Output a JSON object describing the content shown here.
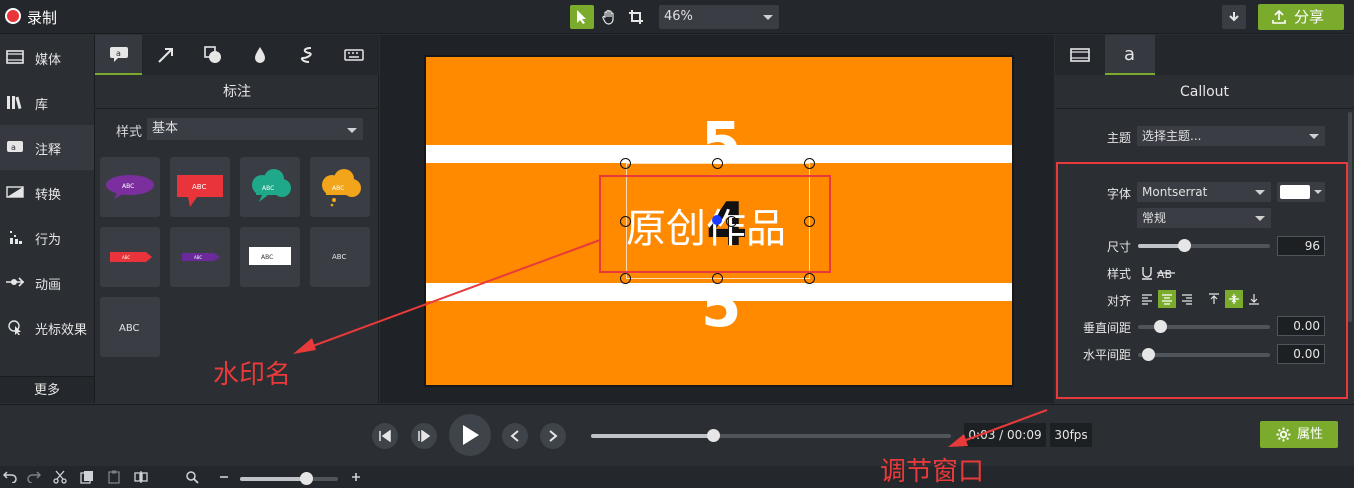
{
  "topbar": {
    "record_label": "录制",
    "zoom_value": "46%",
    "share_label": "分享"
  },
  "nav": {
    "items": [
      {
        "label": "媒体",
        "icon": "film-icon"
      },
      {
        "label": "库",
        "icon": "library-icon"
      },
      {
        "label": "注释",
        "icon": "annotation-icon",
        "active": true
      },
      {
        "label": "转换",
        "icon": "transition-icon"
      },
      {
        "label": "行为",
        "icon": "behavior-icon"
      },
      {
        "label": "动画",
        "icon": "animation-icon"
      },
      {
        "label": "光标效果",
        "icon": "cursor-effect-icon"
      }
    ],
    "more_label": "更多"
  },
  "annotations": {
    "title": "标注",
    "style_label": "样式",
    "style_value": "基本",
    "tiles": [
      "ABC",
      "ABC",
      "ABC",
      "ABC",
      "ABC",
      "ABC",
      "ABC",
      "ABC",
      "ABC"
    ]
  },
  "canvas": {
    "num_top": "5",
    "num_mid": "4",
    "num_bottom": "5",
    "callout_text": "原创作品"
  },
  "properties": {
    "title": "Callout",
    "theme_label": "主题",
    "theme_value": "选择主题...",
    "font_label": "字体",
    "font_value": "Montserrat",
    "weight_value": "常规",
    "size_label": "尺寸",
    "size_value": "96",
    "size_fraction": 0.35,
    "style_label": "样式",
    "align_label": "对齐",
    "vspacing_label": "垂直间距",
    "vspacing_value": "0.00",
    "hspacing_label": "水平间距",
    "hspacing_value": "0.00",
    "text_color": "#ffffff"
  },
  "transport": {
    "time": "0:03 / 00:09",
    "fps": "30fps",
    "progress_fraction": 0.34,
    "properties_label": "属性"
  },
  "overlay": {
    "watermark_label": "水印名",
    "adjust_label": "调节窗口"
  },
  "colors": {
    "accent": "#7aab2d",
    "canvas_bg": "#ff8a00",
    "annotation_red": "#e83a3a"
  }
}
